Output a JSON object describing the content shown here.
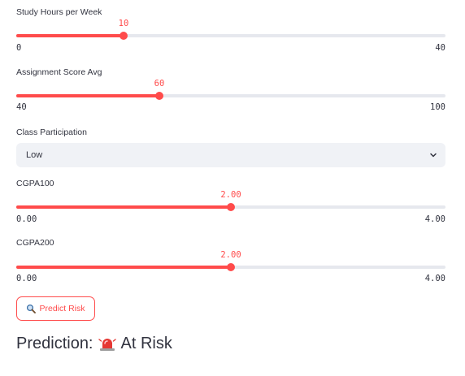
{
  "sliders": [
    {
      "label": "Study Hours per Week",
      "value": "10",
      "min": "0",
      "max": "40",
      "fraction": 0.25
    },
    {
      "label": "Assignment Score Avg",
      "value": "60",
      "min": "40",
      "max": "100",
      "fraction": 0.3333
    },
    {
      "label": "CGPA100",
      "value": "2.00",
      "min": "0.00",
      "max": "4.00",
      "fraction": 0.5
    },
    {
      "label": "CGPA200",
      "value": "2.00",
      "min": "0.00",
      "max": "4.00",
      "fraction": 0.5
    }
  ],
  "participation": {
    "label": "Class Participation",
    "selected": "Low"
  },
  "button": {
    "label": "Predict Risk",
    "icon": "magnifier-icon"
  },
  "prediction": {
    "prefix": "Prediction:",
    "status": "At Risk",
    "icon": "siren-icon"
  },
  "colors": {
    "accent": "#ff4b4b",
    "track": "#e6e8ee",
    "select_bg": "#f0f2f6",
    "text": "#31333f"
  }
}
